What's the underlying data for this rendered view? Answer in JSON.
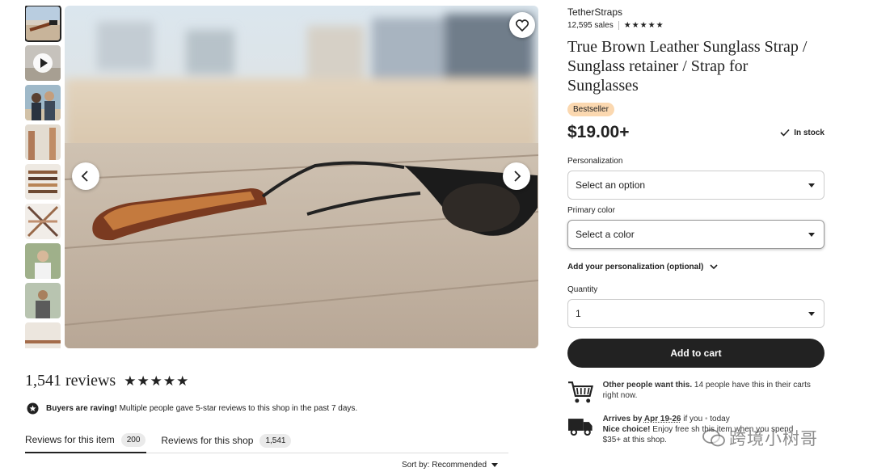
{
  "gallery": {
    "thumbnails": [
      "photo-1",
      "video",
      "photo-3",
      "photo-4",
      "photo-5",
      "photo-6",
      "photo-7",
      "photo-8",
      "photo-9"
    ],
    "favorite_icon": "heart-icon",
    "prev_icon": "chevron-left-icon",
    "next_icon": "chevron-right-icon"
  },
  "shop": {
    "name": "TetherStraps",
    "sales": "12,595 sales",
    "stars": "★★★★★"
  },
  "product": {
    "title": "True Brown Leather Sunglass Strap / Sunglass retainer / Strap for Sunglasses",
    "badge": "Bestseller",
    "price": "$19.00+",
    "stock": "In stock"
  },
  "options": {
    "personalization_label": "Personalization",
    "personalization_value": "Select an option",
    "color_label": "Primary color",
    "color_value": "Select a color",
    "add_personalization": "Add your personalization (optional)",
    "quantity_label": "Quantity",
    "quantity_value": "1"
  },
  "cart": {
    "button_label": "Add to cart"
  },
  "info": {
    "demand_bold": "Other people want this.",
    "demand_text": " 14 people have this in their carts right now.",
    "arrives_bold": "Arrives by ",
    "arrives_date": "Apr 19-26",
    "arrives_text": " if you",
    "arrives_tail": " today",
    "nice_bold": "Nice choice!",
    "nice_text": " Enjoy free sh",
    "nice_tail": "this item when you spend",
    "threshold": "$35+ at this shop."
  },
  "reviews": {
    "title": "1,541 reviews",
    "stars": "★★★★★",
    "raving_bold": "Buyers are raving!",
    "raving_text": " Multiple people gave 5-star reviews to this shop in the past 7 days.",
    "tabs": [
      {
        "label": "Reviews for this item",
        "count": "200"
      },
      {
        "label": "Reviews for this shop",
        "count": "1,541"
      }
    ],
    "sort": "Sort by: Recommended"
  },
  "watermark": {
    "text": "跨境小树哥"
  },
  "colors": {
    "primary": "#222222",
    "badge_bg": "#fbd8b0",
    "pill_bg": "#eaeaea"
  }
}
